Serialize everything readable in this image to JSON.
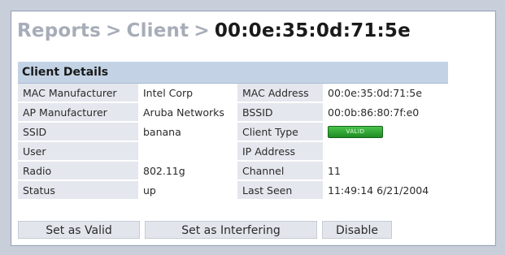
{
  "breadcrumb": {
    "level1": "Reports",
    "separator": ">",
    "level2": "Client",
    "current": "00:0e:35:0d:71:5e"
  },
  "client_details": {
    "title": "Client Details",
    "rows": [
      {
        "label_left": "MAC Manufacturer",
        "value_left": "Intel Corp",
        "label_right": "MAC Address",
        "value_right": "00:0e:35:0d:71:5e"
      },
      {
        "label_left": "AP Manufacturer",
        "value_left": "Aruba Networks",
        "label_right": "BSSID",
        "value_right": "00:0b:86:80:7f:e0"
      },
      {
        "label_left": "SSID",
        "value_left": "banana",
        "label_right": "Client Type",
        "value_right": "VALID"
      },
      {
        "label_left": "User",
        "value_left": "",
        "label_right": "IP Address",
        "value_right": ""
      },
      {
        "label_left": "Radio",
        "value_left": "802.11g",
        "label_right": "Channel",
        "value_right": "11"
      },
      {
        "label_left": "Status",
        "value_left": "up",
        "label_right": "Last Seen",
        "value_right": "11:49:14 6/21/2004"
      }
    ]
  },
  "actions": {
    "set_valid": "Set as Valid",
    "set_interfering": "Set as Interfering",
    "disable": "Disable"
  },
  "colors": {
    "background": "#c8cfdb",
    "header_bar": "#c3d3e5",
    "label_cell": "#e4e7ed",
    "valid_badge": "#2fa535"
  }
}
